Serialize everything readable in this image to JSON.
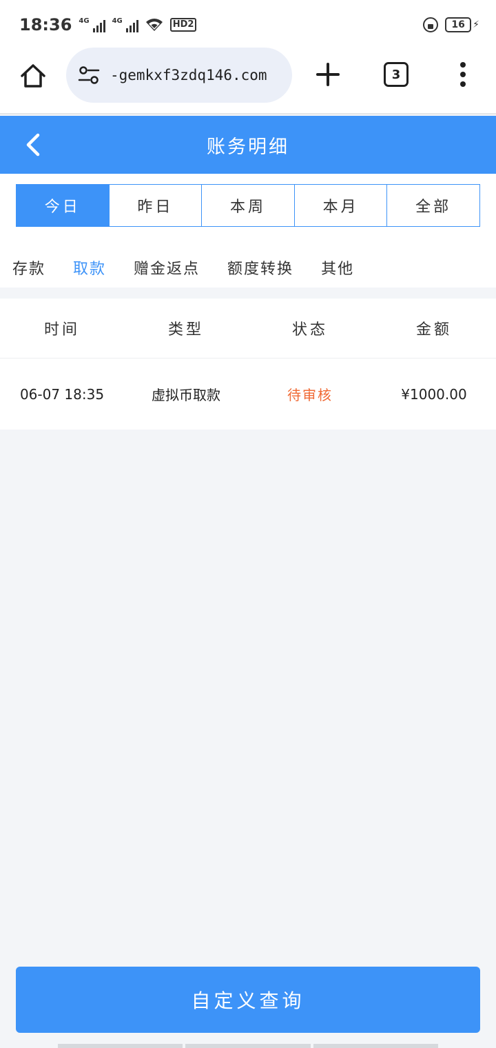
{
  "status_bar": {
    "time": "18:36",
    "signal_1_label": "4G",
    "signal_2_label": "4G",
    "wifi_icon": "wifi-icon",
    "hd_badge": "HD2",
    "battery_level": "16"
  },
  "browser": {
    "url": "-gemkxf3zdq146.com",
    "tab_count": "3"
  },
  "header": {
    "title": "账务明细"
  },
  "period_tabs": [
    {
      "label": "今日",
      "active": true
    },
    {
      "label": "昨日",
      "active": false
    },
    {
      "label": "本周",
      "active": false
    },
    {
      "label": "本月",
      "active": false
    },
    {
      "label": "全部",
      "active": false
    }
  ],
  "category_tabs": [
    {
      "label": "存款",
      "active": false
    },
    {
      "label": "取款",
      "active": true
    },
    {
      "label": "赠金返点",
      "active": false
    },
    {
      "label": "额度转换",
      "active": false
    },
    {
      "label": "其他",
      "active": false
    }
  ],
  "table": {
    "columns": [
      "时间",
      "类型",
      "状态",
      "金额"
    ],
    "rows": [
      {
        "time": "06-07 18:35",
        "type": "虚拟币取款",
        "status": "待审核",
        "amount": "¥1000.00"
      }
    ]
  },
  "colors": {
    "accent": "#3d93f8",
    "pending": "#f06a35"
  },
  "footer": {
    "custom_query_label": "自定义查询"
  }
}
